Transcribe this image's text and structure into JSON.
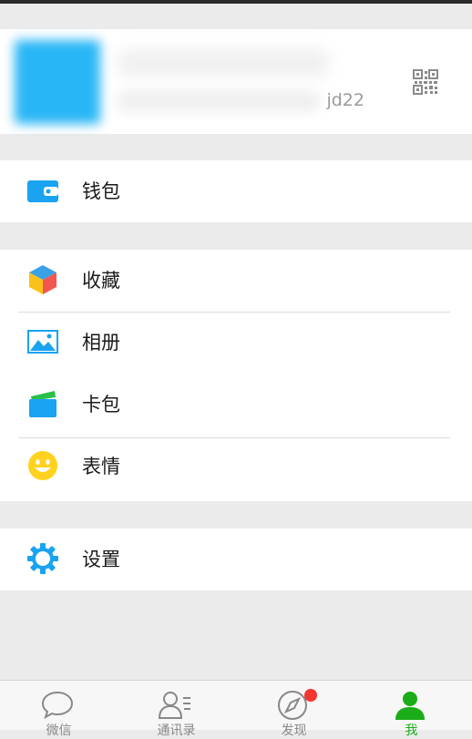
{
  "profile": {
    "id_suffix": "jd22",
    "qr_icon": "qr-code-icon"
  },
  "wallet_section": {
    "items": [
      {
        "label": "钱包",
        "icon": "wallet-icon"
      }
    ]
  },
  "collections_section": {
    "items": [
      {
        "label": "收藏",
        "icon": "favorites-cube-icon"
      },
      {
        "label": "相册",
        "icon": "album-icon"
      },
      {
        "label": "卡包",
        "icon": "card-wallet-icon"
      },
      {
        "label": "表情",
        "icon": "sticker-smile-icon"
      }
    ]
  },
  "settings_section": {
    "items": [
      {
        "label": "设置",
        "icon": "gear-icon"
      }
    ]
  },
  "tabbar": {
    "tabs": [
      {
        "label": "微信",
        "icon": "chat-bubble-icon",
        "active": false
      },
      {
        "label": "通讯录",
        "icon": "contacts-icon",
        "active": false
      },
      {
        "label": "发现",
        "icon": "compass-icon",
        "active": false,
        "badge": true
      },
      {
        "label": "我",
        "icon": "person-icon",
        "active": true
      }
    ]
  },
  "colors": {
    "accent_green": "#1aad19",
    "icon_blue": "#1aa3f1",
    "badge_red": "#f43530",
    "background": "#ebebeb"
  }
}
